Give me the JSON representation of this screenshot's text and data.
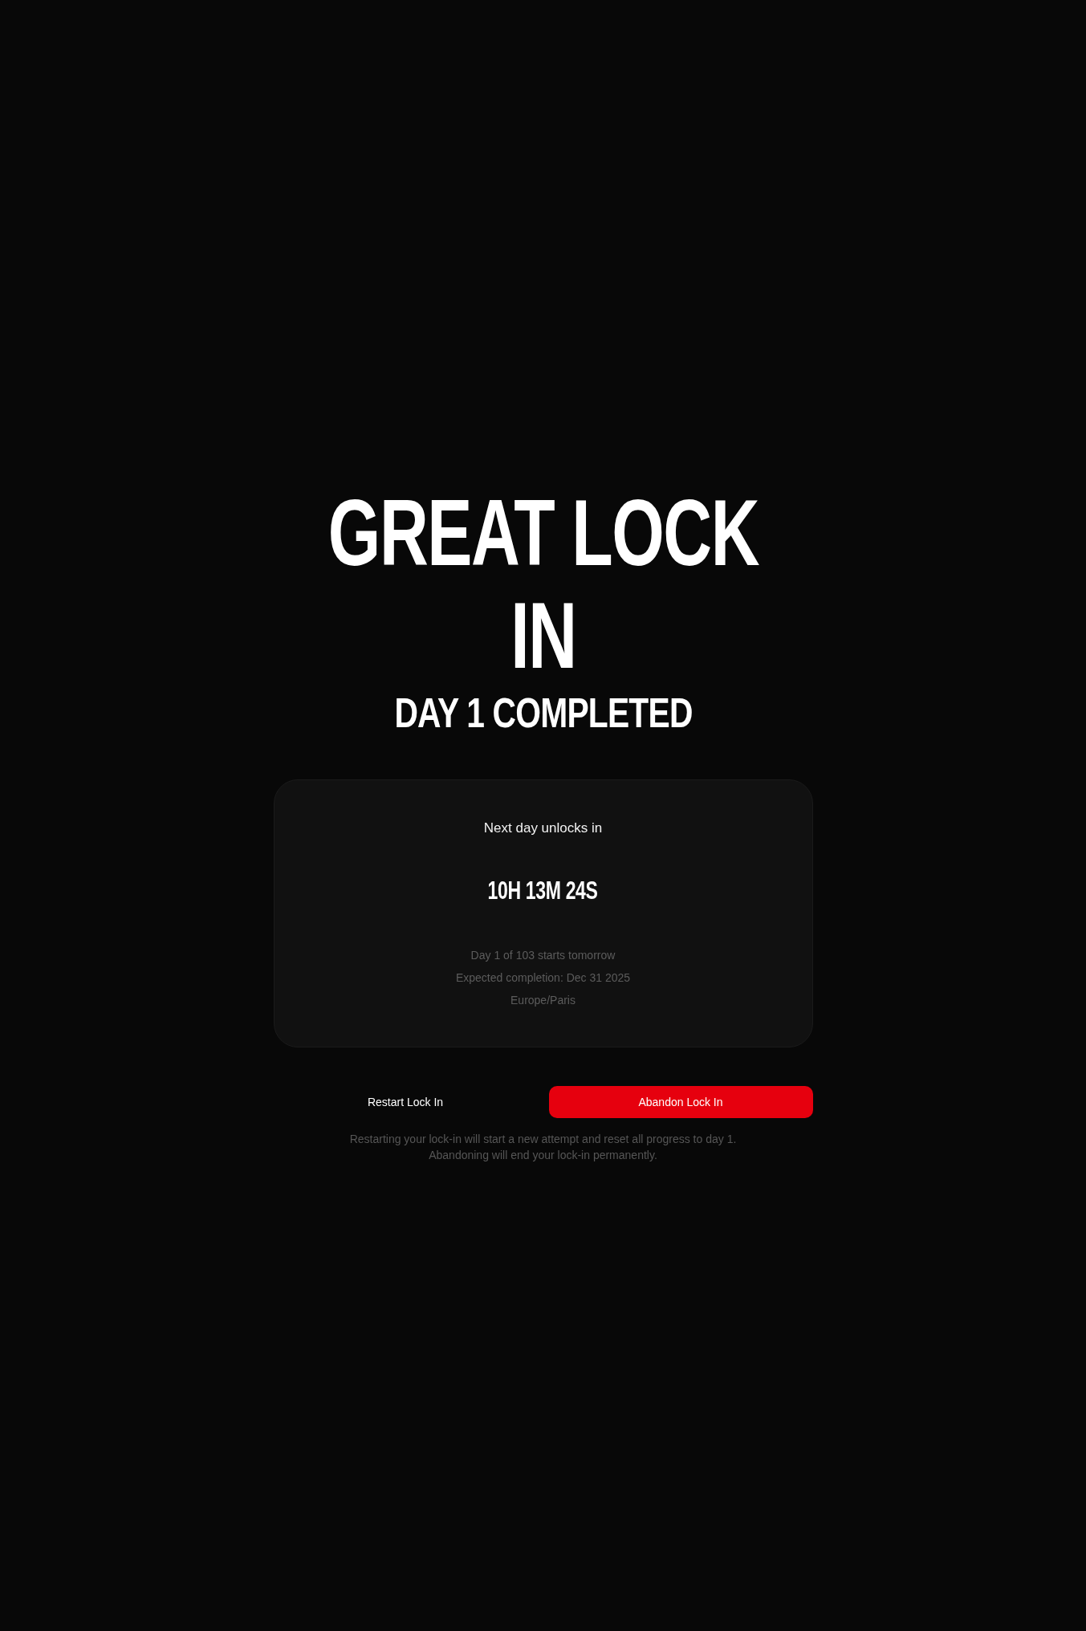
{
  "title": "GREAT LOCK IN",
  "subtitle": "DAY 1 COMPLETED",
  "countdown": {
    "label": "Next day unlocks in",
    "time": "10H 13M 24S",
    "details": [
      "Day 1 of 103 starts tomorrow",
      "Expected completion: Dec 31 2025",
      "Europe/Paris"
    ]
  },
  "buttons": [
    {
      "label": "Restart Lock In",
      "kind": "secondary"
    },
    {
      "label": "Abandon Lock In",
      "kind": "danger"
    }
  ],
  "notes": [
    "Restarting your lock-in will start a new attempt and reset all progress to day 1.",
    "Abandoning will end your lock-in permanently."
  ]
}
